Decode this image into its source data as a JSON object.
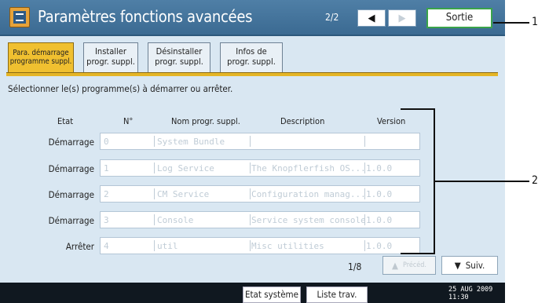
{
  "header": {
    "title": "Paramètres fonctions avancées",
    "page_indicator": "2/2",
    "prev_icon": "left-triangle",
    "next_icon": "right-triangle",
    "exit_label": "Sortie"
  },
  "tabs": [
    {
      "line1": "Para. démarrage",
      "line2": "programme suppl."
    },
    {
      "line1": "Installer",
      "line2": "progr. suppl."
    },
    {
      "line1": "Désinstaller",
      "line2": "progr. suppl."
    },
    {
      "line1": "Infos de",
      "line2": "progr. suppl."
    }
  ],
  "instruction": "Sélectionner le(s) programme(s) à démarrer ou arrêter.",
  "table": {
    "columns": [
      "Etat",
      "N°",
      "Nom progr. suppl.",
      "Description",
      "Version"
    ],
    "rows": [
      {
        "state": "Démarrage",
        "num": "0",
        "name": "System Bundle",
        "desc": "",
        "version": ""
      },
      {
        "state": "Démarrage",
        "num": "1",
        "name": "Log Service",
        "desc": "The Knopflerfish OS...",
        "version": "1.0.0"
      },
      {
        "state": "Démarrage",
        "num": "2",
        "name": "CM Service",
        "desc": "Configuration manag...",
        "version": "1.0.0"
      },
      {
        "state": "Démarrage",
        "num": "3",
        "name": "Console",
        "desc": "Service system console",
        "version": "1.0.0"
      },
      {
        "state": "Arrêter",
        "num": "4",
        "name": "util",
        "desc": "Misc utilities",
        "version": "1.0.0"
      }
    ]
  },
  "pagination": {
    "page": "1/8",
    "prev_label": "Précéd.",
    "next_label": "Suiv."
  },
  "statusbar": {
    "system_status": "Etat système",
    "job_list": "Liste trav.",
    "date": "25 AUG  2009",
    "time": "11:30"
  },
  "callouts": {
    "one": "1",
    "two": "2"
  }
}
